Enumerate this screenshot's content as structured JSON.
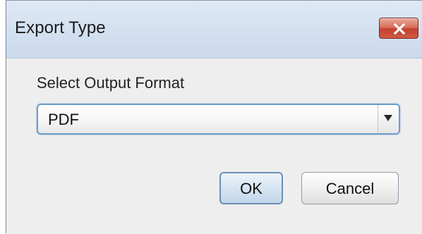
{
  "window": {
    "title": "Export Type",
    "close_icon": "close-x-icon"
  },
  "form": {
    "label": "Select Output Format",
    "selected_value": "PDF",
    "dropdown_icon": "chevron-down-icon"
  },
  "buttons": {
    "ok_label": "OK",
    "cancel_label": "Cancel"
  },
  "colors": {
    "close_button": "#cf4a36",
    "focus_border": "#6c9cc9",
    "titlebar": "#d4e1f1"
  }
}
